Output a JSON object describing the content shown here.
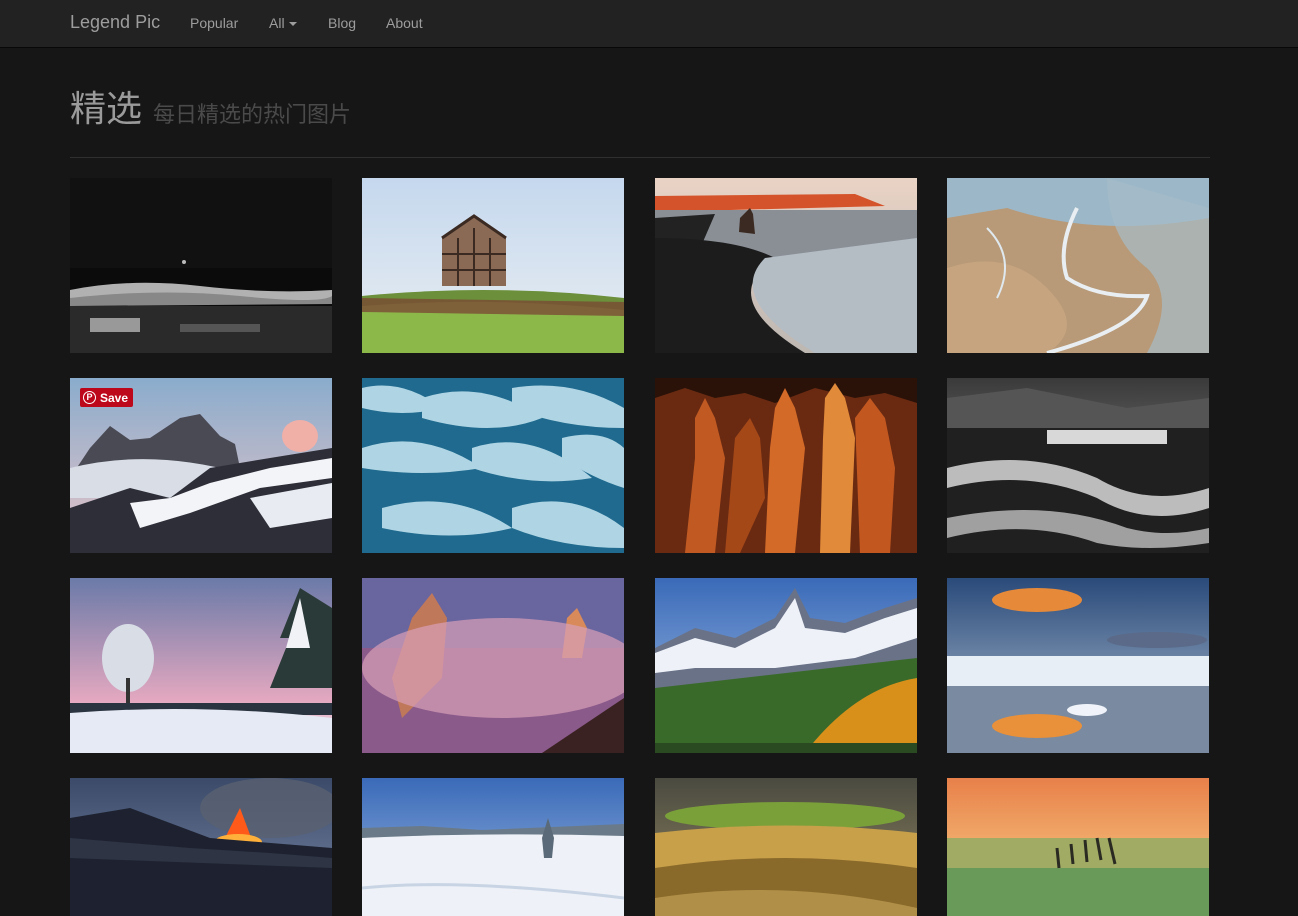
{
  "nav": {
    "brand": "Legend Pic",
    "items": [
      {
        "label": "Popular"
      },
      {
        "label": "All"
      },
      {
        "label": "Blog"
      },
      {
        "label": "About"
      }
    ]
  },
  "header": {
    "title": "精选",
    "subtitle": "每日精选的热门图片"
  },
  "pin_button": {
    "label": "Save",
    "logo": "P"
  },
  "photos": [
    {
      "name": "night-moon-mountains"
    },
    {
      "name": "barn-on-hill"
    },
    {
      "name": "black-sand-beach"
    },
    {
      "name": "aerial-river-delta"
    },
    {
      "name": "snowy-peaks-clouds"
    },
    {
      "name": "glacier-ice-waves"
    },
    {
      "name": "canyon-hoodoos"
    },
    {
      "name": "bw-waterfall-river"
    },
    {
      "name": "snowy-trees-dusk"
    },
    {
      "name": "misty-pink-peaks"
    },
    {
      "name": "patagonia-mountain"
    },
    {
      "name": "glacier-lagoon-sunset"
    },
    {
      "name": "volcano-eruption"
    },
    {
      "name": "winter-snow-field"
    },
    {
      "name": "rolling-fields-sunlight"
    },
    {
      "name": "pier-sunset-sea"
    }
  ],
  "colors": {
    "navbar": "#222222",
    "background": "#161616",
    "pin": "#bd081c"
  }
}
